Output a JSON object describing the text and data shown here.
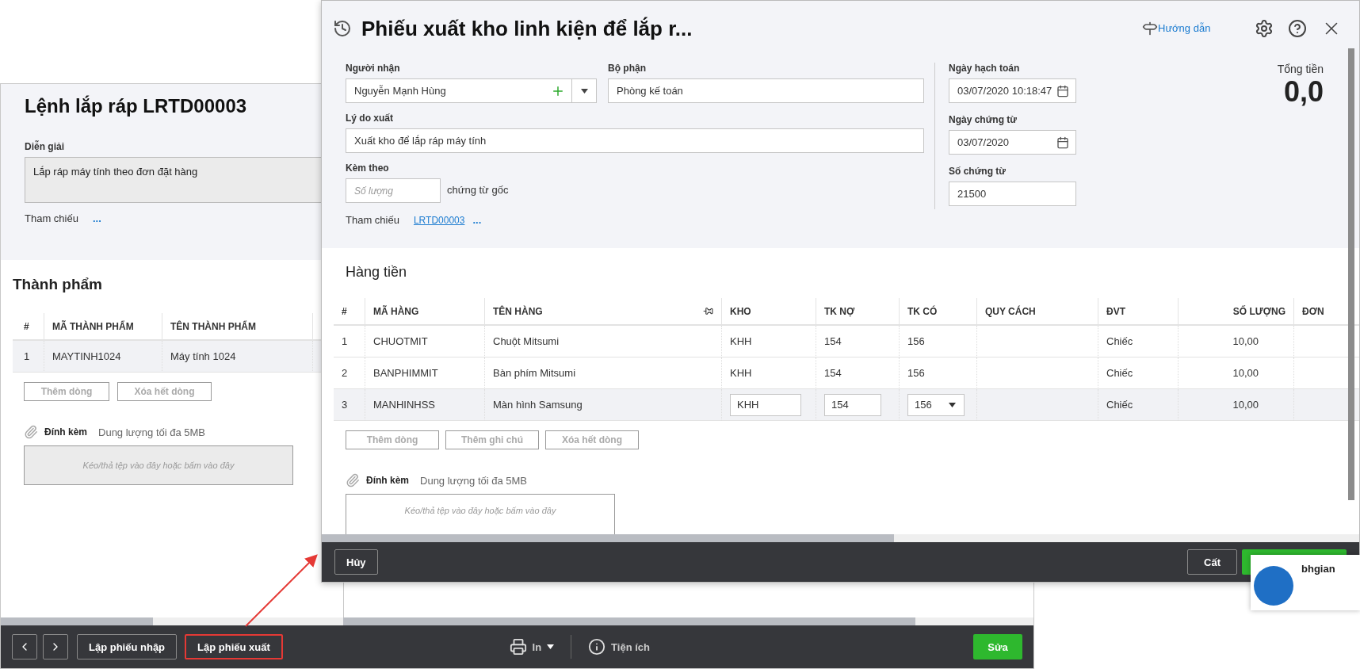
{
  "background_window": {
    "title": "Lệnh lắp ráp LRTD00003",
    "description": {
      "label": "Diễn giải",
      "value": "Lắp ráp máy tính theo đơn đặt hàng"
    },
    "reference": {
      "label": "Tham chiếu",
      "more": "..."
    },
    "section_title": "Thành phẩm",
    "table": {
      "columns": [
        "#",
        "MÃ THÀNH PHẨM",
        "TÊN THÀNH PHẨM"
      ],
      "rows": [
        [
          "1",
          "MAYTINH1024",
          "Máy tính 1024"
        ]
      ]
    },
    "row_buttons": [
      {
        "label": "Thêm dòng",
        "disabled": true
      },
      {
        "label": "Xóa hết dòng",
        "disabled": true
      }
    ],
    "attachment": {
      "label": "Đính kèm",
      "limit": "Dung lượng tối đa 5MB",
      "placeholder": "Kéo/thả tệp vào đây hoặc bấm vào đây"
    },
    "toolbar": {
      "buttons": [
        {
          "kind": "prev"
        },
        {
          "kind": "next"
        },
        {
          "kind": "text",
          "label": "Lập phiếu nhập",
          "highlighted": false
        },
        {
          "kind": "text",
          "label": "Lập phiếu xuất",
          "highlighted": true
        }
      ],
      "print": "In",
      "utilities": "Tiện ích",
      "edit": "Sửa"
    }
  },
  "dialog": {
    "title": "Phiếu xuất kho linh kiện để lắp r...",
    "help": "Hướng dẫn",
    "receiver": {
      "label": "Người nhận",
      "value": "Nguyễn Mạnh Hùng"
    },
    "department": {
      "label": "Bộ phận",
      "value": "Phòng kế toán"
    },
    "reason": {
      "label": "Lý do xuất",
      "value": "Xuất kho để lắp ráp máy tính"
    },
    "attached": {
      "label": "Kèm theo",
      "placeholder": "Số lượng",
      "suffix": "chứng từ gốc"
    },
    "reference": {
      "label": "Tham chiếu",
      "link": "LRTD00003",
      "more": "..."
    },
    "posting_date": {
      "label": "Ngày hạch toán",
      "value": "03/07/2020 10:18:47"
    },
    "voucher_date": {
      "label": "Ngày chứng từ",
      "value": "03/07/2020"
    },
    "voucher_no": {
      "label": "Số chứng từ",
      "value": "21500"
    },
    "total": {
      "label": "Tổng tiền",
      "value": "0,0"
    },
    "section_title": "Hàng tiền",
    "table": {
      "columns": [
        "#",
        "MÃ HÀNG",
        "TÊN HÀNG",
        "KHO",
        "TK NỢ",
        "TK CÓ",
        "QUY CÁCH",
        "ĐVT",
        "SỐ LƯỢNG",
        "ĐƠN"
      ],
      "rows": [
        {
          "cells": [
            "1",
            "CHUOTMIT",
            "Chuột Mitsumi",
            "KHH",
            "154",
            "156",
            "",
            "Chiếc",
            "10,00"
          ],
          "editing": false
        },
        {
          "cells": [
            "2",
            "BANPHIMMIT",
            "Bàn phím Mitsumi",
            "KHH",
            "154",
            "156",
            "",
            "Chiếc",
            "10,00"
          ],
          "editing": false
        },
        {
          "cells": [
            "3",
            "MANHINHSS",
            "Màn hình Samsung",
            "KHH",
            "154",
            "156",
            "",
            "Chiếc",
            "10,00"
          ],
          "editing": true
        }
      ]
    },
    "row_buttons": [
      {
        "label": "Thêm dòng",
        "disabled": true
      },
      {
        "label": "Thêm ghi chú",
        "disabled": true
      },
      {
        "label": "Xóa hết dòng",
        "disabled": true
      }
    ],
    "attachment": {
      "label": "Đính kèm",
      "limit": "Dung lượng tối đa 5MB",
      "placeholder": "Kéo/thả tệp vào đây hoặc bấm vào đây"
    },
    "footer": {
      "cancel": "Hủy",
      "save": "Cất"
    }
  },
  "notification": {
    "text": "bhgian"
  }
}
